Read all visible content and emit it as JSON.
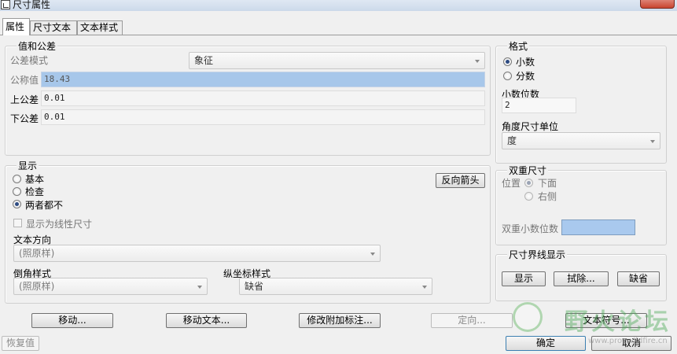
{
  "window": {
    "title": "尺寸属性"
  },
  "tabs": [
    {
      "label": "属性",
      "active": true
    },
    {
      "label": "尺寸文本",
      "active": false
    },
    {
      "label": "文本样式",
      "active": false
    }
  ],
  "value_tolerance": {
    "title": "值和公差",
    "tolerance_mode_label": "公差模式",
    "tolerance_mode_value": "象征",
    "nominal_label": "公称值",
    "nominal_value": "18.43",
    "upper_label": "上公差",
    "upper_value": "0.01",
    "lower_label": "下公差",
    "lower_value": "0.01"
  },
  "format": {
    "title": "格式",
    "options": [
      {
        "label": "小数",
        "checked": true
      },
      {
        "label": "分数",
        "checked": false
      }
    ],
    "decimal_places_label": "小数位数",
    "decimal_places_value": "2",
    "angular_units_label": "角度尺寸单位",
    "angular_units_value": "度"
  },
  "display": {
    "title": "显示",
    "options": [
      {
        "label": "基本",
        "checked": false
      },
      {
        "label": "检查",
        "checked": false
      },
      {
        "label": "两者都不",
        "checked": true
      }
    ],
    "flip_arrows_label": "反向箭头",
    "show_linear_label": "显示为线性尺寸",
    "text_orientation_label": "文本方向",
    "text_orientation_value": "(照原样)",
    "chamfer_style_label": "倒角样式",
    "chamfer_style_value": "(照原样)",
    "ordinate_style_label": "纵坐标样式",
    "ordinate_style_value": "缺省"
  },
  "dual_dimension": {
    "title": "双重尺寸",
    "position_label": "位置",
    "position_options": [
      {
        "label": "下面",
        "checked": true
      },
      {
        "label": "右侧",
        "checked": false
      }
    ],
    "dual_decimal_label": "双重小数位数"
  },
  "witness_line": {
    "title": "尺寸界线显示",
    "show_label": "显示",
    "erase_label": "拭除...",
    "default_label": "缺省"
  },
  "bottom_buttons": {
    "move": "移动...",
    "move_text": "移动文本...",
    "edit_attach": "修改附加标注...",
    "orient": "定向...",
    "text_symbol": "文本符号...",
    "restore": "恢复值",
    "ok": "确定",
    "cancel": "取消"
  },
  "watermark": {
    "text": "野火论坛",
    "url": "www.proewildfire.cn"
  }
}
